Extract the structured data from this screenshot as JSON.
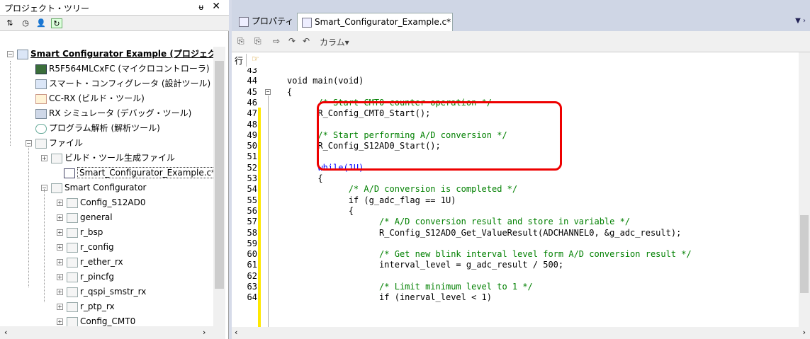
{
  "tree": {
    "title": "プロジェクト・ツリー",
    "pin": "ᵾ",
    "close": "✕",
    "rows": [
      {
        "label": "Smart Configurator Example (プロジェク",
        "icon": "project-icon",
        "bold": true,
        "underline": true,
        "expand": "−"
      },
      {
        "label": "R5F564MLCxFC (マイクロコントローラ)",
        "icon": "chip-icon"
      },
      {
        "label": "スマート・コンフィグレータ (設計ツール)",
        "icon": "config-tool-icon"
      },
      {
        "label": "CC-RX (ビルド・ツール)",
        "icon": "build-tool-icon"
      },
      {
        "label": "RX シミュレータ (デバッグ・ツール)",
        "icon": "simulator-icon"
      },
      {
        "label": "プログラム解析 (解析ツール)",
        "icon": "analysis-icon"
      },
      {
        "label": "ファイル",
        "icon": "folder-icon",
        "expand": "−"
      },
      {
        "label": "ビルド・ツール生成ファイル",
        "icon": "folder-icon",
        "expand": "+"
      },
      {
        "label": "Smart_Configurator_Example.c*",
        "icon": "c-file-icon",
        "selected": true
      },
      {
        "label": "Smart Configurator",
        "icon": "folder-icon",
        "expand": "−"
      },
      {
        "label": "Config_S12AD0",
        "icon": "folder-icon",
        "expand": "+"
      },
      {
        "label": "general",
        "icon": "folder-icon",
        "expand": "+"
      },
      {
        "label": "r_bsp",
        "icon": "folder-icon",
        "expand": "+"
      },
      {
        "label": "r_config",
        "icon": "folder-icon",
        "expand": "+"
      },
      {
        "label": "r_ether_rx",
        "icon": "folder-icon",
        "expand": "+"
      },
      {
        "label": "r_pincfg",
        "icon": "folder-icon",
        "expand": "+"
      },
      {
        "label": "r_qspi_smstr_rx",
        "icon": "folder-icon",
        "expand": "+"
      },
      {
        "label": "r_ptp_rx",
        "icon": "folder-icon",
        "expand": "+"
      },
      {
        "label": "Config_CMT0",
        "icon": "folder-icon",
        "expand": "+"
      }
    ]
  },
  "editor": {
    "tab_properties": "プロパティ",
    "tab_file": "Smart_Configurator_Example.c*",
    "toolbar_column": "カラム▾",
    "gutter_label": "行",
    "lines": [
      {
        "n": "43",
        "t": ""
      },
      {
        "n": "44",
        "t": "void main(void)"
      },
      {
        "n": "45",
        "t": "{"
      },
      {
        "n": "46",
        "t": "\t/* Start CMT0 counter operation */",
        "cls": "cm"
      },
      {
        "n": "47",
        "t": "\tR_Config_CMT0_Start();"
      },
      {
        "n": "48",
        "t": ""
      },
      {
        "n": "49",
        "t": "\t/* Start performing A/D conversion */",
        "cls": "cm"
      },
      {
        "n": "50",
        "t": "\tR_Config_S12AD0_Start();"
      },
      {
        "n": "51",
        "t": ""
      },
      {
        "n": "52",
        "t": "\twhile(1U)",
        "cls": "kw"
      },
      {
        "n": "53",
        "t": "\t{"
      },
      {
        "n": "54",
        "t": "\t\t/* A/D conversion is completed */",
        "cls": "cm"
      },
      {
        "n": "55",
        "t": "\t\tif (g_adc_flag == 1U)"
      },
      {
        "n": "56",
        "t": "\t\t{"
      },
      {
        "n": "57",
        "t": "\t\t\t/* A/D conversion result and store in variable */",
        "cls": "cm"
      },
      {
        "n": "58",
        "t": "\t\t\tR_Config_S12AD0_Get_ValueResult(ADCHANNEL0, &g_adc_result);"
      },
      {
        "n": "59",
        "t": ""
      },
      {
        "n": "60",
        "t": "\t\t\t/* Get new blink interval level form A/D conversion result */",
        "cls": "cm"
      },
      {
        "n": "61",
        "t": "\t\t\tinterval_level = g_adc_result / 500;"
      },
      {
        "n": "62",
        "t": ""
      },
      {
        "n": "63",
        "t": "\t\t\t/* Limit minimum level to 1 */",
        "cls": "cm"
      },
      {
        "n": "64",
        "t": "\t\t\tif (inerval_level < 1)"
      }
    ]
  },
  "colors": {
    "highlight_box": "#e00000",
    "comment": "#008000",
    "keyword": "#0000ff"
  }
}
